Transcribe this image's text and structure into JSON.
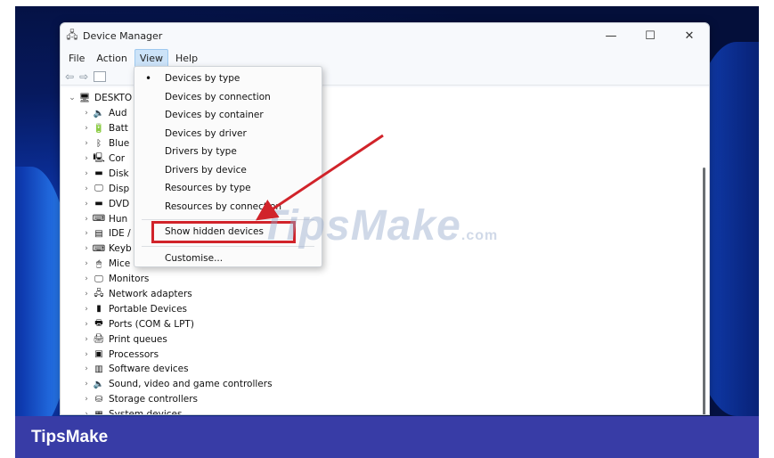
{
  "window": {
    "title": "Device Manager",
    "controls": [
      "—",
      "☐",
      "✕"
    ]
  },
  "menubar": {
    "items": [
      "File",
      "Action",
      "View",
      "Help"
    ],
    "active": "View"
  },
  "tree": {
    "root": "DESKTO",
    "items_truncated": [
      "Aud",
      "Batt",
      "Blue",
      "Cor",
      "Disk",
      "Disp",
      "DVD",
      "Hun",
      "IDE /",
      "Keyb",
      "Mice"
    ],
    "items_full": [
      "Monitors",
      "Network adapters",
      "Portable Devices",
      "Ports (COM & LPT)",
      "Print queues",
      "Processors",
      "Software devices",
      "Sound, video and game controllers",
      "Storage controllers",
      "System devices"
    ]
  },
  "view_menu": {
    "items": [
      "Devices by type",
      "Devices by connection",
      "Devices by container",
      "Devices by driver",
      "Drivers by type",
      "Drivers by device",
      "Resources by type",
      "Resources by connection",
      "Show hidden devices",
      "Customise..."
    ],
    "checked": "Devices by type",
    "highlighted": "Show hidden devices"
  },
  "watermark": {
    "text": "TipsMake",
    "suffix": ".com"
  },
  "footer": {
    "brand": "TipsMake"
  },
  "colors": {
    "highlight_border": "#d1232a",
    "footer_bg": "#383ca6",
    "arrow": "#d1232a"
  }
}
